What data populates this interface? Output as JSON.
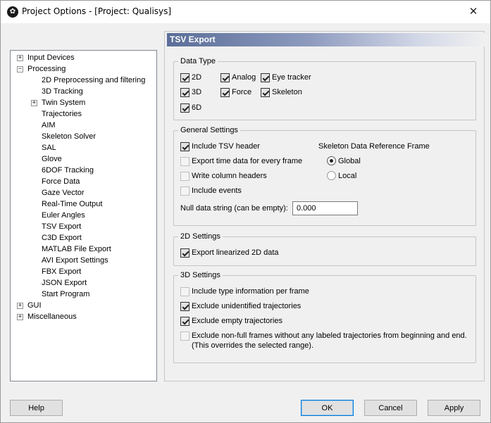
{
  "window": {
    "title": "Project Options - [Project: Qualisys]"
  },
  "tree": {
    "items": [
      {
        "label": "Input Devices",
        "expander": "+"
      },
      {
        "label": "Processing",
        "expander": "-"
      },
      {
        "label": "2D Preprocessing and filtering"
      },
      {
        "label": "3D Tracking"
      },
      {
        "label": "Twin System",
        "expander": "+"
      },
      {
        "label": "Trajectories"
      },
      {
        "label": "AIM"
      },
      {
        "label": "Skeleton Solver"
      },
      {
        "label": "SAL"
      },
      {
        "label": "Glove"
      },
      {
        "label": "6DOF Tracking"
      },
      {
        "label": "Force Data"
      },
      {
        "label": "Gaze Vector"
      },
      {
        "label": "Real-Time Output"
      },
      {
        "label": "Euler Angles"
      },
      {
        "label": "TSV Export"
      },
      {
        "label": "C3D Export"
      },
      {
        "label": "MATLAB File Export"
      },
      {
        "label": "AVI Export Settings"
      },
      {
        "label": "FBX Export"
      },
      {
        "label": "JSON Export"
      },
      {
        "label": "Start Program"
      },
      {
        "label": "GUI",
        "expander": "+"
      },
      {
        "label": "Miscellaneous",
        "expander": "+"
      }
    ]
  },
  "panel": {
    "title": "TSV Export"
  },
  "data_type": {
    "title": "Data Type",
    "options": [
      {
        "label": "2D",
        "checked": true
      },
      {
        "label": "Analog",
        "checked": true
      },
      {
        "label": "Eye tracker",
        "checked": true
      },
      {
        "label": "3D",
        "checked": true
      },
      {
        "label": "Force",
        "checked": true
      },
      {
        "label": "Skeleton",
        "checked": true
      },
      {
        "label": "6D",
        "checked": true
      }
    ]
  },
  "general": {
    "title": "General Settings",
    "options": [
      {
        "label": "Include TSV header",
        "checked": true
      },
      {
        "label": "Export time data for every frame",
        "checked": false
      },
      {
        "label": "Write column headers",
        "checked": false
      },
      {
        "label": "Include events",
        "checked": false
      }
    ],
    "null_label": "Null data string (can be empty):",
    "null_value": "0.000",
    "skeleton_ref_title": "Skeleton Data Reference Frame",
    "radio": [
      {
        "label": "Global",
        "selected": true
      },
      {
        "label": "Local",
        "selected": false
      }
    ]
  },
  "settings_2d": {
    "title": "2D Settings",
    "options": [
      {
        "label": "Export linearized 2D data",
        "checked": true
      }
    ]
  },
  "settings_3d": {
    "title": "3D Settings",
    "options": [
      {
        "label": "Include type information per frame",
        "checked": false
      },
      {
        "label": "Exclude unidentified trajectories",
        "checked": true
      },
      {
        "label": "Exclude empty trajectories",
        "checked": true
      },
      {
        "label": "Exclude non-full frames without any labeled trajectories from beginning and end.",
        "checked": false
      }
    ],
    "note": "(This overrides the selected range)."
  },
  "buttons": {
    "help": "Help",
    "ok": "OK",
    "cancel": "Cancel",
    "apply": "Apply"
  }
}
